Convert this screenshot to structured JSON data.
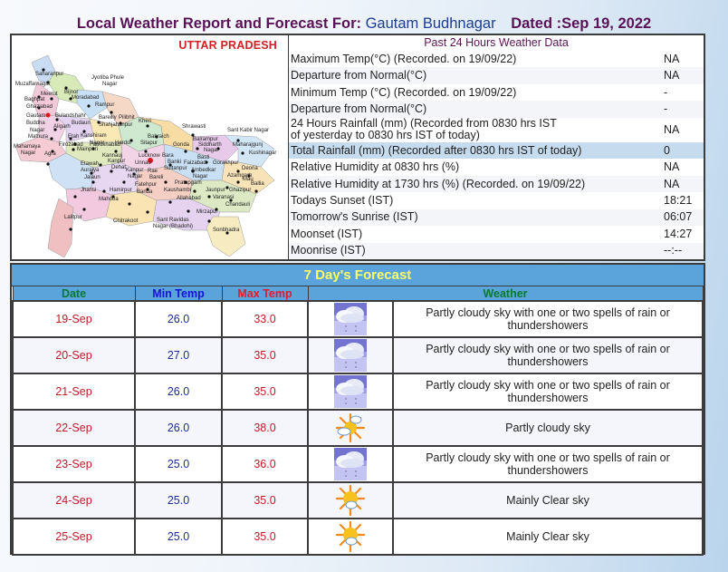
{
  "header": {
    "title_prefix": "Local Weather Report and Forecast For:",
    "place": "Gautam Budhnagar",
    "dated": "Dated :Sep 19, 2022"
  },
  "map": {
    "title": "UTTAR PRADESH",
    "selected_district": "Gautam Buddha Nagar",
    "district_labels": [
      "Saharanpur",
      "Muzaffarnagar",
      "Jyotiba Phule Nagar",
      "Bijnor",
      "Meerut",
      "Moradabad",
      "Baghpat",
      "Rampur",
      "Ghaziabad",
      "Pilibhit",
      "Gautam Buddha Nagar",
      "Bulandshahr",
      "Bareilly",
      "Budaun",
      "Shahjahanpur",
      "Kheri",
      "Aligarh",
      "Mathura",
      "Etah",
      "Kanshiram Nagar",
      "Shrawasti",
      "Sant Kabir Nagar",
      "Hardoi",
      "Bahraich",
      "Balrampur",
      "Mahamaya Nagar",
      "Firozabad",
      "Mainpuri",
      "Farrukhabad",
      "Sitapur",
      "Gonda",
      "Siddharth Nagar",
      "Maharajganj",
      "Agra",
      "Kannauj",
      "Lucknow",
      "Bara Banki",
      "Basti",
      "Kushinagar",
      "Etawah",
      "Kanpur Dehat",
      "Unnao",
      "Faizabad",
      "Gorakhpur",
      "Auraiya",
      "Kanpur Nagar",
      "Rae Bareli",
      "Sultanpur",
      "Ambedkar Nagar",
      "Deoria",
      "Azamgarh",
      "Mau",
      "Jalaun",
      "Fatehpur",
      "Pratapgarh",
      "Ballia",
      "Jhansi",
      "Hamirpur",
      "Banda",
      "Kaushambi",
      "Jaunpur",
      "Ghazipur",
      "Mahoba",
      "Allahabad",
      "Varanasi",
      "Chandauli",
      "Lalitpur",
      "Chitrakoot",
      "Sant Ravidas Nagar (Bhadohi)",
      "Mirzapur",
      "Sonbhadra"
    ]
  },
  "past24": {
    "heading": "Past 24 Hours Weather Data",
    "rows": [
      {
        "label": "Maximum Temp(°C) (Recorded. on 19/09/22)",
        "value": "NA"
      },
      {
        "label": "Departure from Normal(°C)",
        "value": "NA"
      },
      {
        "label": "Minimum Temp (°C) (Recorded. on 19/09/22)",
        "value": "-"
      },
      {
        "label": "Departure from Normal(°C)",
        "value": "-"
      },
      {
        "label": "24 Hours Rainfall (mm) (Recorded from 0830 hrs IST",
        "label2": "of yesterday to 0830 hrs IST of today)",
        "value": "NA"
      },
      {
        "label": "Total Rainfall (mm) (Recorded after 0830 hrs IST of today)",
        "value": "0"
      },
      {
        "label": "Relative Humidity at 0830 hrs (%)",
        "value": "NA"
      },
      {
        "label": "Relative Humidity at 1730 hrs (%) (Recorded. on 19/09/22)",
        "value": "NA"
      },
      {
        "label": "Todays Sunset (IST)",
        "value": "18:21"
      },
      {
        "label": "Tomorrow's Sunrise (IST)",
        "value": "06:07"
      },
      {
        "label": "Moonset (IST)",
        "value": "14:27"
      },
      {
        "label": "Moonrise (IST)",
        "value": "--:--"
      }
    ]
  },
  "forecast": {
    "title": "7 Day's Forecast",
    "columns": {
      "date": "Date",
      "min": "Min Temp",
      "max": "Max Temp",
      "weather": "Weather"
    },
    "rows": [
      {
        "date": "19-Sep",
        "min": "26.0",
        "max": "33.0",
        "icon": "rain-cloud-icon",
        "weather": "Partly cloudy sky with one or two spells of rain or thundershowers"
      },
      {
        "date": "20-Sep",
        "min": "27.0",
        "max": "35.0",
        "icon": "rain-cloud-icon",
        "weather": "Partly cloudy sky with one or two spells of rain or thundershowers"
      },
      {
        "date": "21-Sep",
        "min": "26.0",
        "max": "35.0",
        "icon": "rain-cloud-icon",
        "weather": "Partly cloudy sky with one or two spells of rain or thundershowers"
      },
      {
        "date": "22-Sep",
        "min": "26.0",
        "max": "38.0",
        "icon": "partly-cloudy-icon",
        "weather": "Partly cloudy sky"
      },
      {
        "date": "23-Sep",
        "min": "25.0",
        "max": "36.0",
        "icon": "rain-cloud-icon",
        "weather": "Partly cloudy sky with one or two spells of rain or thundershowers"
      },
      {
        "date": "24-Sep",
        "min": "25.0",
        "max": "35.0",
        "icon": "mainly-clear-icon",
        "weather": "Mainly Clear sky"
      },
      {
        "date": "25-Sep",
        "min": "25.0",
        "max": "35.0",
        "icon": "mainly-clear-icon",
        "weather": "Mainly Clear sky"
      }
    ]
  },
  "colors": {
    "title": "#5b1357",
    "place": "#1d3d96",
    "forecast_header_bg": "#5aa3db",
    "forecast_title": "#ffff66",
    "highlight_row": "#c6dcee"
  }
}
